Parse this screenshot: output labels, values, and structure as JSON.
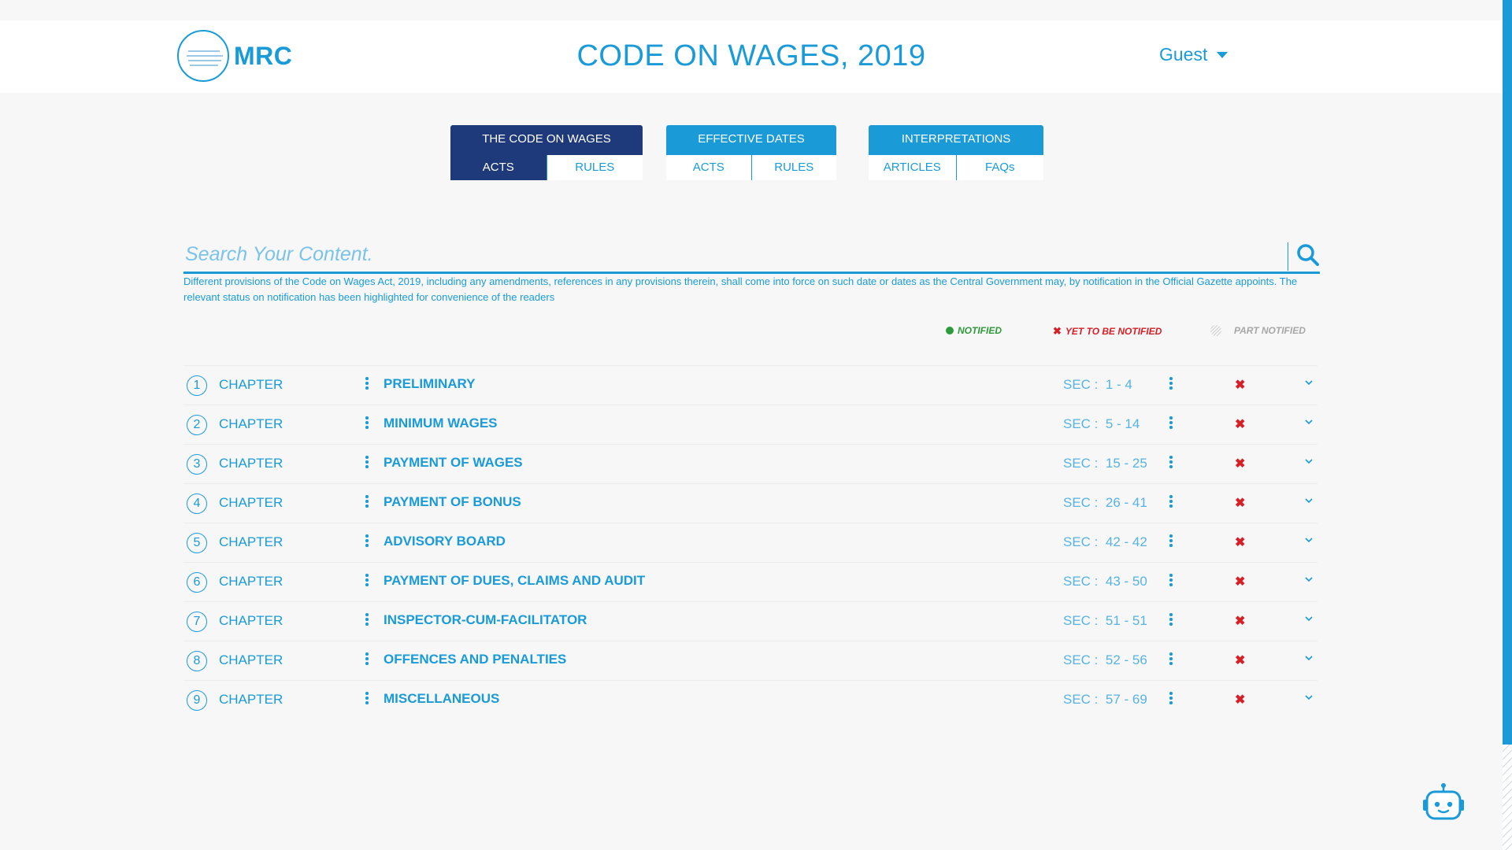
{
  "header": {
    "logo_text": "MRC",
    "title": "CODE ON WAGES, 2019",
    "user": "Guest"
  },
  "tabs": [
    {
      "title": "THE CODE ON WAGES",
      "color": "#1f3a7a",
      "items": [
        "ACTS",
        "RULES"
      ],
      "active": 0
    },
    {
      "title": "EFFECTIVE DATES",
      "color": "#1a9bd7",
      "items": [
        "ACTS",
        "RULES"
      ],
      "active": -1
    },
    {
      "title": "INTERPRETATIONS",
      "color": "#1a9bd7",
      "items": [
        "ARTICLES",
        "FAQs"
      ],
      "active": -1
    }
  ],
  "search": {
    "placeholder": "Search Your Content.",
    "icon": "search-icon"
  },
  "notice": "Different provisions of the Code on Wages Act, 2019, including any amendments, references in any provisions therein, shall come into force on such date or dates as the Central Government may, by notification in the Official Gazette appoints. The relevant status on notification has been highlighted for convenience of the readers",
  "legend": {
    "notified": "NOTIFIED",
    "yet_to_be_notified": "YET TO BE NOTIFIED",
    "part_notified": "PART NOTIFIED",
    "colors": {
      "notified": "#2e9b3b",
      "yet_to_be_notified": "#d71f26",
      "part_notified": "#a7a7a7"
    }
  },
  "chapters": [
    {
      "num": "1",
      "label": "CHAPTER",
      "title": "PRELIMINARY",
      "sec_label": "SEC :",
      "sec_range": "1 - 4",
      "status": "yet-to-be-notified"
    },
    {
      "num": "2",
      "label": "CHAPTER",
      "title": "MINIMUM WAGES",
      "sec_label": "SEC :",
      "sec_range": "5 - 14",
      "status": "yet-to-be-notified"
    },
    {
      "num": "3",
      "label": "CHAPTER",
      "title": "PAYMENT OF WAGES",
      "sec_label": "SEC :",
      "sec_range": "15 - 25",
      "status": "yet-to-be-notified"
    },
    {
      "num": "4",
      "label": "CHAPTER",
      "title": "PAYMENT OF BONUS",
      "sec_label": "SEC :",
      "sec_range": "26 - 41",
      "status": "yet-to-be-notified"
    },
    {
      "num": "5",
      "label": "CHAPTER",
      "title": "ADVISORY BOARD",
      "sec_label": "SEC :",
      "sec_range": "42 - 42",
      "status": "yet-to-be-notified"
    },
    {
      "num": "6",
      "label": "CHAPTER",
      "title": "PAYMENT OF DUES, CLAIMS AND AUDIT",
      "sec_label": "SEC :",
      "sec_range": "43 - 50",
      "status": "yet-to-be-notified"
    },
    {
      "num": "7",
      "label": "CHAPTER",
      "title": "INSPECTOR-CUM-FACILITATOR",
      "sec_label": "SEC :",
      "sec_range": "51 - 51",
      "status": "yet-to-be-notified"
    },
    {
      "num": "8",
      "label": "CHAPTER",
      "title": "OFFENCES AND PENALTIES",
      "sec_label": "SEC :",
      "sec_range": "52 - 56",
      "status": "yet-to-be-notified"
    },
    {
      "num": "9",
      "label": "CHAPTER",
      "title": "MISCELLANEOUS",
      "sec_label": "SEC :",
      "sec_range": "57 - 69",
      "status": "yet-to-be-notified"
    }
  ],
  "colors": {
    "accent": "#1a9bd7",
    "navy": "#1f3a7a",
    "red": "#d71f26"
  },
  "chatbot": {
    "icon": "chatbot-icon"
  }
}
